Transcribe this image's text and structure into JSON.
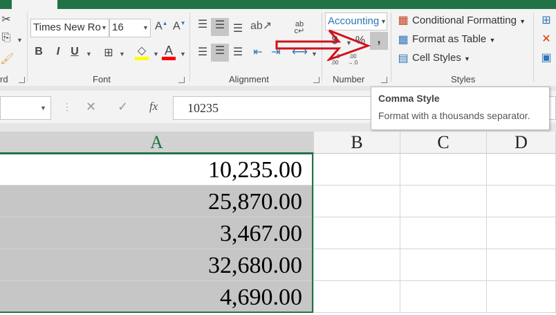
{
  "ribbon": {
    "clipboard_label": "rd",
    "font": {
      "name": "Times New Ro",
      "size": "16",
      "bold": "B",
      "italic": "I",
      "underline": "U",
      "font_color_letter": "A",
      "label": "Font",
      "fill_color": "#ffff00",
      "font_color": "#ff0000"
    },
    "alignment": {
      "label": "Alignment",
      "wrap_text": "ab c↵"
    },
    "number": {
      "format": "Accounting",
      "currency": "$",
      "percent": "%",
      "comma": ",",
      "inc_decimal": "←.0 .00",
      "dec_decimal": ".00 →.0",
      "label": "Number"
    },
    "styles": {
      "conditional_formatting": "Conditional Formatting",
      "format_as_table": "Format as Table",
      "cell_styles": "Cell Styles",
      "label": "Styles"
    }
  },
  "formula_bar": {
    "cancel": "✕",
    "enter": "✓",
    "fx": "fx",
    "value": "10235"
  },
  "tooltip": {
    "title": "Comma Style",
    "description": "Format with a thousands separator."
  },
  "grid": {
    "columns": [
      "A",
      "B",
      "C",
      "D"
    ],
    "cells_A": [
      "10,235.00",
      "25,870.00",
      "3,467.00",
      "32,680.00",
      "4,690.00"
    ]
  },
  "colors": {
    "accent": "#217346",
    "arrow": "#d0111b",
    "selection": "#c6c6c6"
  }
}
